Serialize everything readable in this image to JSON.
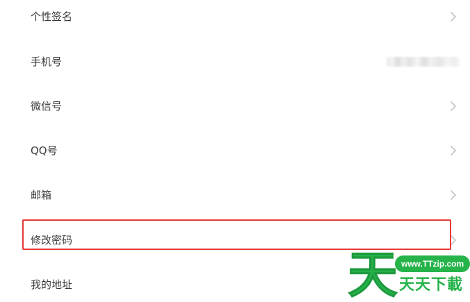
{
  "settings": {
    "items": [
      {
        "label": "个性签名",
        "has_arrow": true
      },
      {
        "label": "手机号",
        "has_arrow": false,
        "value_blurred": true
      },
      {
        "label": "微信号",
        "has_arrow": true
      },
      {
        "label": "QQ号",
        "has_arrow": true
      },
      {
        "label": "邮箱",
        "has_arrow": true
      },
      {
        "label": "修改密码",
        "has_arrow": true,
        "highlighted": true
      },
      {
        "label": "我的地址",
        "has_arrow": false
      }
    ]
  },
  "highlight": {
    "color": "#e53935",
    "target": "修改密码"
  },
  "watermark": {
    "logo_char": "天",
    "url": "www.TTzip.com",
    "name": "天天下載",
    "color": "#25b34a"
  },
  "icons": {
    "arrow": "chevron-right-icon"
  }
}
